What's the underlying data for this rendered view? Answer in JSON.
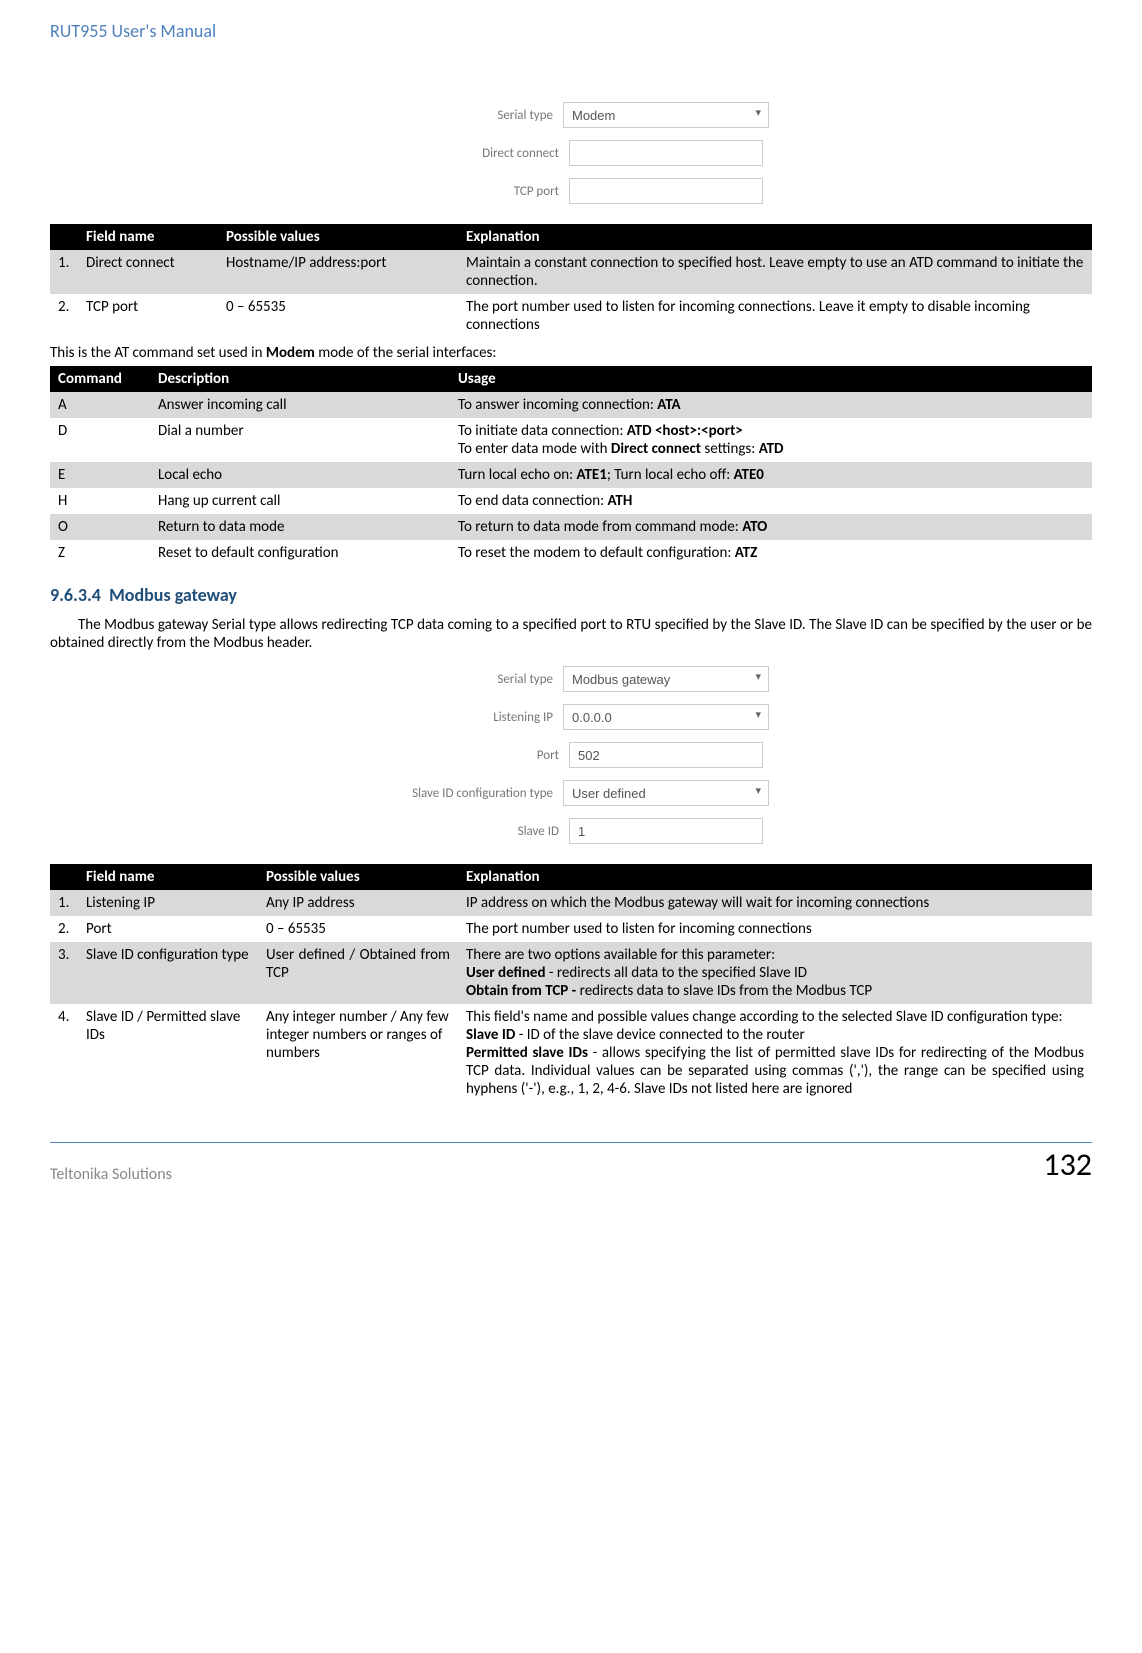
{
  "header": {
    "title": "RUT955 User's Manual"
  },
  "form1": {
    "serial_type_label": "Serial type",
    "serial_type_value": "Modem",
    "direct_connect_label": "Direct connect",
    "direct_connect_value": "",
    "tcp_port_label": "TCP port",
    "tcp_port_value": ""
  },
  "table1": {
    "headers": {
      "blank": "",
      "field": "Field name",
      "values": "Possible values",
      "expl": "Explanation"
    },
    "rows": [
      {
        "n": "1.",
        "field": "Direct connect",
        "values": "Hostname/IP address:port",
        "expl": "Maintain a constant connection to specified host. Leave empty to use an ATD command to initiate the connection."
      },
      {
        "n": "2.",
        "field": "TCP port",
        "values": "0 – 65535",
        "expl": "The port number used to listen for incoming connections. Leave it empty to disable incoming connections"
      }
    ]
  },
  "at_intro_pre": "This is the AT command set used in ",
  "at_intro_bold": "Modem",
  "at_intro_post": " mode of the serial interfaces:",
  "table2": {
    "headers": {
      "cmd": "Command",
      "desc": "Description",
      "usage": "Usage"
    },
    "rows": [
      {
        "cmd": "A",
        "desc": "Answer incoming call",
        "usage_pre": "To answer incoming connection: ",
        "usage_b1": "ATA",
        "usage_mid": "",
        "usage_b2": ""
      },
      {
        "cmd": "D",
        "desc": "Dial a number",
        "usage_pre": "To initiate data connection: ",
        "usage_b1": "ATD <host>:<port>",
        "usage_mid": "\nTo enter data mode with ",
        "usage_b1b": "Direct connect",
        "usage_mid2": " settings: ",
        "usage_b2": "ATD"
      },
      {
        "cmd": "E",
        "desc": "Local echo",
        "usage_pre": "Turn local echo on: ",
        "usage_b1": "ATE1",
        "usage_mid": "; Turn local echo off: ",
        "usage_b2": "ATE0"
      },
      {
        "cmd": "H",
        "desc": "Hang up current call",
        "usage_pre": "To end data connection: ",
        "usage_b1": "ATH",
        "usage_mid": "",
        "usage_b2": ""
      },
      {
        "cmd": "O",
        "desc": "Return to data mode",
        "usage_pre": "To return to data mode from command mode: ",
        "usage_b1": "ATO",
        "usage_mid": "",
        "usage_b2": ""
      },
      {
        "cmd": "Z",
        "desc": "Reset to default configuration",
        "usage_pre": "To reset the modem to default configuration: ",
        "usage_b1": "ATZ",
        "usage_mid": "",
        "usage_b2": ""
      }
    ]
  },
  "section": {
    "number": "9.6.3.4",
    "title": "Modbus gateway"
  },
  "paragraph": "The Modbus gateway Serial type allows redirecting TCP data coming to a specified port to RTU specified by the Slave ID. The Slave ID can be specified by the user or be obtained directly from the Modbus header.",
  "form2": {
    "serial_type_label": "Serial type",
    "serial_type_value": "Modbus gateway",
    "listening_ip_label": "Listening IP",
    "listening_ip_value": "0.0.0.0",
    "port_label": "Port",
    "port_value": "502",
    "slave_cfg_label": "Slave ID configuration type",
    "slave_cfg_value": "User defined",
    "slave_id_label": "Slave ID",
    "slave_id_value": "1"
  },
  "table3": {
    "headers": {
      "blank": "",
      "field": "Field name",
      "values": "Possible values",
      "expl": "Explanation"
    },
    "rows": [
      {
        "n": "1.",
        "field": "Listening IP",
        "values": "Any IP address",
        "expl": "IP address on which the Modbus gateway will wait for incoming connections"
      },
      {
        "n": "2.",
        "field": "Port",
        "values": "0 – 65535",
        "expl": "The port number used to listen for incoming connections"
      },
      {
        "n": "3.",
        "field": "Slave ID configuration type",
        "values": "User defined / Obtained from TCP",
        "expl_pre": "There are two options available for this parameter:",
        "expl_b1": "User defined",
        "expl_b1t": " - redirects all data to the specified Slave ID",
        "expl_b2": "Obtain from TCP - ",
        "expl_b2t": "redirects data to slave IDs from the Modbus TCP"
      },
      {
        "n": "4.",
        "field": "Slave ID / Permitted slave IDs",
        "values": "Any integer number / Any few integer numbers or ranges of numbers",
        "expl_pre": "This field's name and possible values change according to the selected Slave ID configuration type:",
        "expl_b1": "Slave ID",
        "expl_b1t": " - ID of the slave device connected to the router",
        "expl_b2": "Permitted slave IDs",
        "expl_b2t": " - allows specifying the list of permitted slave IDs for redirecting of the Modbus TCP data. Individual values can be separated using commas (','), the range can be specified using hyphens ('-'), e.g., 1, 2, 4-6. Slave IDs not listed here are ignored"
      }
    ]
  },
  "footer": {
    "left": "Teltonika Solutions",
    "right": "132"
  }
}
